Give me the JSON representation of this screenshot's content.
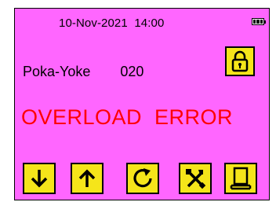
{
  "status_bar": {
    "datetime": "10-Nov-2021  14:00",
    "battery_icon": "battery-full-icon"
  },
  "info": {
    "mode_label": "Poka-Yoke",
    "mode_value": "020"
  },
  "lock_button": {
    "icon": "lock-icon"
  },
  "error_message": "OVERLOAD  ERROR",
  "buttons": [
    {
      "name": "down-arrow-button",
      "icon": "arrow-down-icon"
    },
    {
      "name": "up-arrow-button",
      "icon": "arrow-up-icon"
    },
    {
      "name": "refresh-button",
      "icon": "refresh-icon"
    },
    {
      "name": "tools-button",
      "icon": "tools-icon"
    },
    {
      "name": "monitor-button",
      "icon": "monitor-icon"
    }
  ],
  "colors": {
    "screen_background": "#ff66ff",
    "button_background": "#f5e51a",
    "error_text": "#ff0000"
  }
}
